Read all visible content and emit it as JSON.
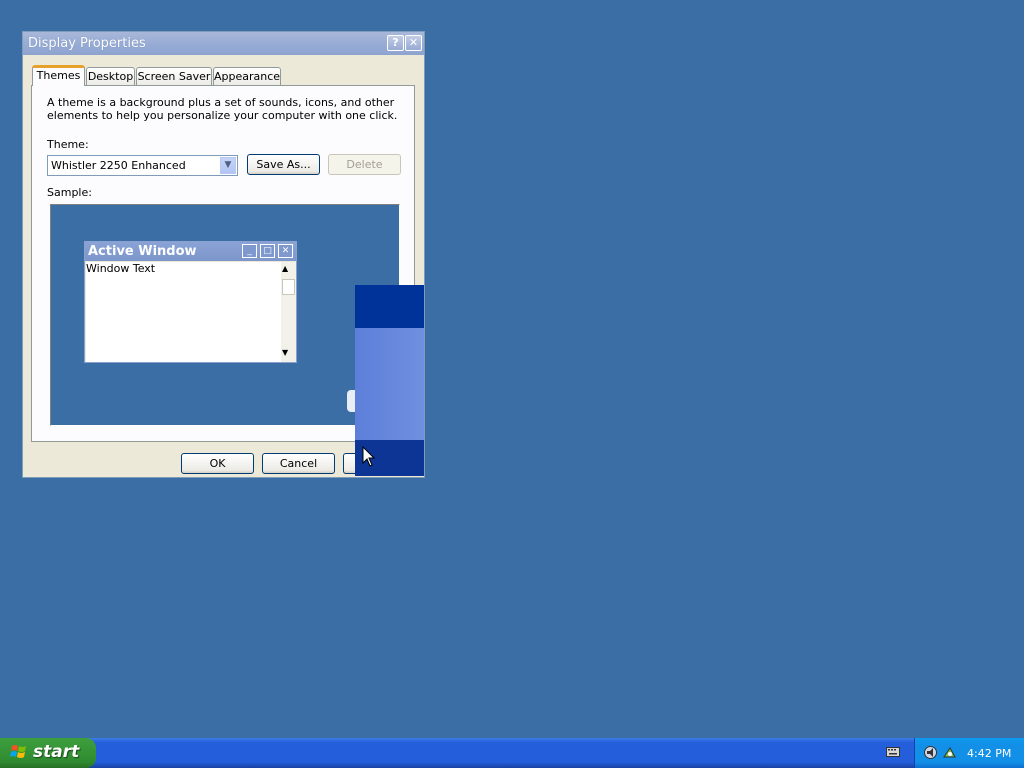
{
  "dialog": {
    "title": "Display Properties",
    "help_glyph": "?",
    "close_glyph": "✕",
    "tabs": [
      {
        "label": "Themes",
        "active": true
      },
      {
        "label": "Desktop",
        "active": false
      },
      {
        "label": "Screen Saver",
        "active": false
      },
      {
        "label": "Appearance",
        "active": false
      }
    ],
    "description": "A theme is a background plus a set of sounds, icons, and other elements to help you personalize your computer with one click.",
    "theme_label": "Theme:",
    "theme_value": "Whistler 2250 Enhanced",
    "save_as_label": "Save As...",
    "delete_label": "Delete",
    "sample_label": "Sample:",
    "sample_window": {
      "title": "Active Window",
      "text": "Window Text"
    },
    "ok_label": "OK",
    "cancel_label": "Cancel"
  },
  "taskbar": {
    "start_label": "start",
    "clock": "4:42 PM"
  },
  "colors": {
    "desktop": "#3a6ea5",
    "taskbar": "#245edb",
    "start_button": "#3a9a3a",
    "tray": "#1290e8"
  }
}
